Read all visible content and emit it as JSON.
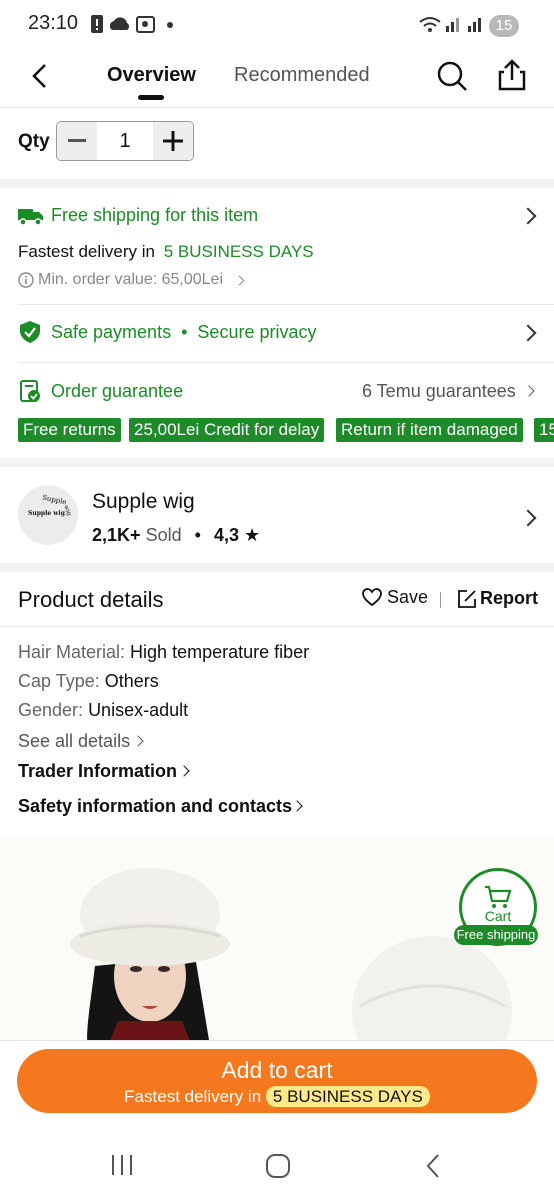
{
  "status_bar": {
    "time": "23:10",
    "battery": "15"
  },
  "header": {
    "tabs": [
      "Overview",
      "Recommended"
    ]
  },
  "qty": {
    "label": "Qty",
    "value": "1"
  },
  "shipping": {
    "title": "Free shipping for this item",
    "fastest_prefix": "Fastest delivery in",
    "fastest_days": "5 BUSINESS DAYS",
    "min_order": "Min. order value: 65,00Lei"
  },
  "payments": {
    "safe": "Safe payments",
    "dot": "•",
    "privacy": "Secure privacy"
  },
  "guarantee": {
    "title": "Order guarantee",
    "count": "6 Temu guarantees",
    "badges": [
      "Free returns",
      "25,00Lei Credit for delay",
      "Return if item damaged",
      "15"
    ]
  },
  "store": {
    "name": "Supple wig",
    "logo_text_top": "Supple",
    "logo_text_mid": "Supple wig",
    "logo_text_side": "wig",
    "sold": "2,1K+",
    "sold_label": "Sold",
    "dot": "•",
    "rating": "4,3",
    "star": "★"
  },
  "product_details": {
    "title": "Product details",
    "save": "Save",
    "report": "Report",
    "rows": [
      {
        "key": "Hair Material:",
        "value": "High temperature fiber"
      },
      {
        "key": "Cap Type:",
        "value": "Others"
      },
      {
        "key": "Gender:",
        "value": "Unisex-adult"
      }
    ],
    "see_all": "See all details",
    "trader": "Trader Information",
    "safety": "Safety information and contacts"
  },
  "cart_float": {
    "label": "Cart",
    "badge": "Free shipping"
  },
  "add_to_cart": {
    "title": "Add to cart",
    "sub_prefix": "Fastest delivery in",
    "sub_days": "5 BUSINESS DAYS"
  },
  "colors": {
    "accent_green": "#1d8c28",
    "orange": "#f5781e",
    "highlight": "#ffe98a"
  }
}
